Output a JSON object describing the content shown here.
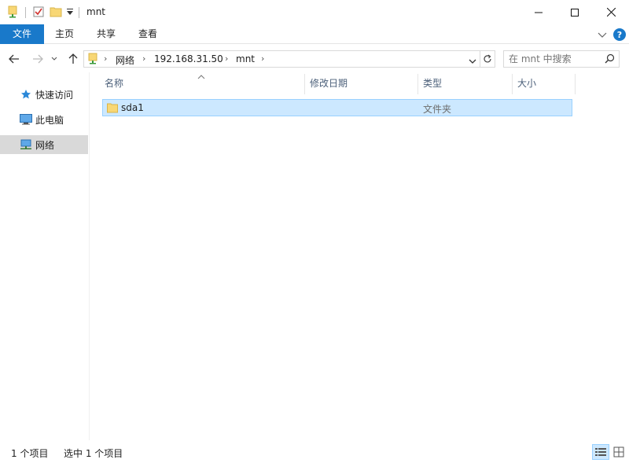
{
  "window": {
    "title": "mnt"
  },
  "ribbon": {
    "tabs": [
      {
        "label": "文件"
      },
      {
        "label": "主页"
      },
      {
        "label": "共享"
      },
      {
        "label": "查看"
      }
    ]
  },
  "address": {
    "crumbs": [
      "网络",
      "192.168.31.50",
      "mnt"
    ]
  },
  "search": {
    "placeholder": "在 mnt 中搜索"
  },
  "sidebar": {
    "items": [
      {
        "label": "快速访问",
        "icon": "star-icon"
      },
      {
        "label": "此电脑",
        "icon": "computer-icon"
      },
      {
        "label": "网络",
        "icon": "network-icon",
        "selected": true
      }
    ]
  },
  "columns": [
    {
      "label": "名称"
    },
    {
      "label": "修改日期"
    },
    {
      "label": "类型"
    },
    {
      "label": "大小"
    }
  ],
  "files": [
    {
      "name": "sda1",
      "date": "",
      "type": "文件夹",
      "size": "",
      "selected": true
    }
  ],
  "status": {
    "count": "1 个项目",
    "selected": "选中 1 个项目"
  },
  "colors": {
    "accent": "#1979ca",
    "selection_bg": "#cce8ff",
    "selection_border": "#99d1ff",
    "folder": "#f8d775"
  }
}
